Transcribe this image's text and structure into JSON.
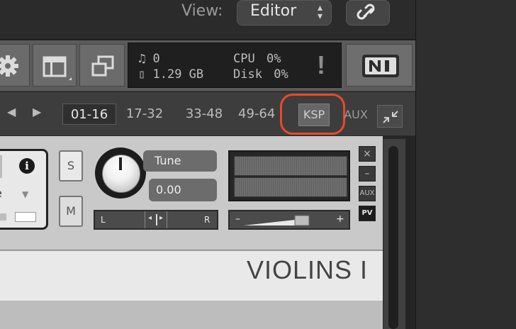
{
  "toolbar": {
    "view_label": "View:",
    "view_value": "Editor"
  },
  "header": {
    "voices_count": "0",
    "memory": "1.29 GB",
    "cpu_label": "CPU",
    "cpu_value": "0%",
    "disk_label": "Disk",
    "disk_value": "0%",
    "warning": "!"
  },
  "rack": {
    "pages": [
      "01-16",
      "17-32",
      "33-48",
      "49-64"
    ],
    "ksp_label": "KSP",
    "aux_label": "AUX"
  },
  "instrument": {
    "solo_label": "S",
    "mute_label": "M",
    "tune_label": "Tune",
    "tune_value": "0.00",
    "pan_left": "L",
    "pan_right": "R",
    "volume_minus": "–",
    "volume_plus": "+",
    "close_label": "×",
    "minimize_label": "–",
    "aux_label": "AUX",
    "pv_label": "PV",
    "name": "VIOLINS I"
  },
  "colors": {
    "highlight": "#e84a2c",
    "panel": "#5b5b5b",
    "rack": "#3d3d3d"
  }
}
